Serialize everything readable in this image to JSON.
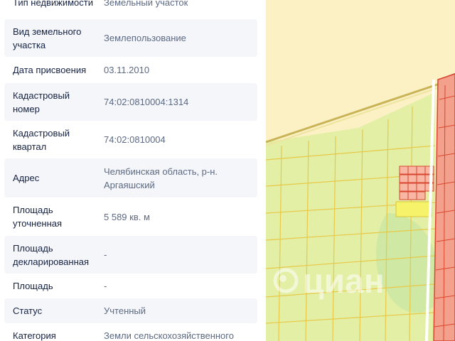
{
  "details": {
    "rows": [
      {
        "key": "Тип недвижимости",
        "value": "Земельный участок"
      },
      {
        "key": "Вид земельного участка",
        "value": "Землепользование"
      },
      {
        "key": "Дата присвоения",
        "value": "03.11.2010"
      },
      {
        "key": "Кадастровый номер",
        "value": "74:02:0810004:1314"
      },
      {
        "key": "Кадастровый квартал",
        "value": "74:02:0810004"
      },
      {
        "key": "Адрес",
        "value": "Челябинская область, р-н. Аргаяшский"
      },
      {
        "key": "Площадь уточненная",
        "value": "5 589 кв. м"
      },
      {
        "key": "Площадь декларированная",
        "value": "-"
      },
      {
        "key": "Площадь",
        "value": "-"
      },
      {
        "key": "Статус",
        "value": "Учтенный"
      },
      {
        "key": "Категория",
        "value": "Земли сельскохозяйственного"
      }
    ]
  },
  "map": {
    "watermark": "циан",
    "colors": {
      "background": "#fbf1c4",
      "parcels_green": "#e3efa4",
      "forest": "#cfe8a3",
      "parcel_lines": "#e7c94a",
      "road": "#c9b458",
      "urban_red": "#f3a18c",
      "urban_border": "#d9462f",
      "selected_parcel": "#f6f26a"
    }
  }
}
